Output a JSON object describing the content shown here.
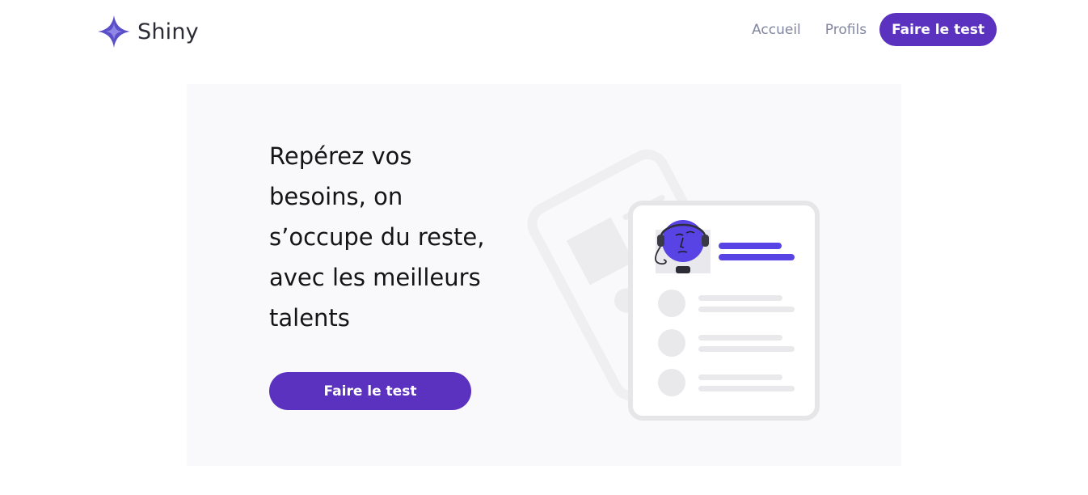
{
  "header": {
    "logo_text": "Shiny",
    "logo_icon": "sparkle-star-icon",
    "nav": {
      "home_label": "Accueil",
      "profiles_label": "Profils",
      "cta_label": "Faire le test"
    }
  },
  "hero": {
    "title": "Repérez vos besoins, on s’occupe du reste, avec les meilleurs talents",
    "cta_label": "Faire le test",
    "illustration_icon": "profile-card-illustration"
  },
  "colors": {
    "accent": "#5b32bf",
    "illustration_accent": "#5843e4",
    "hero_background": "#f9f9fc",
    "nav_text": "#8186a0"
  }
}
